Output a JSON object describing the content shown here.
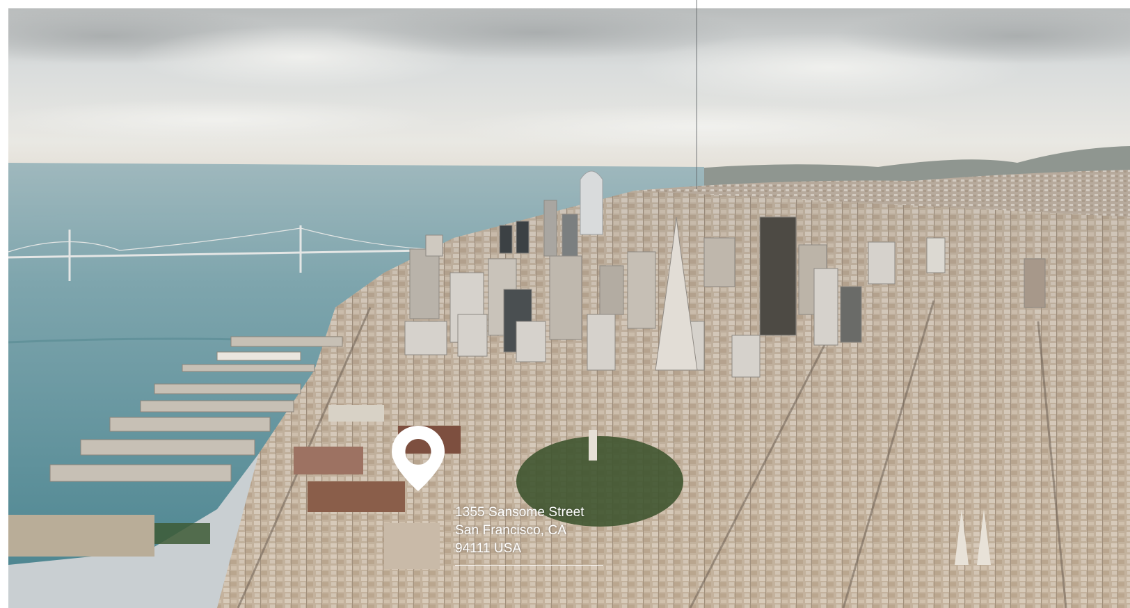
{
  "address": {
    "street": "1355 Sansome Street",
    "city": "San Francisco, CA",
    "postal": "94111 USA"
  },
  "colors": {
    "pin": "#ffffff",
    "text": "#ffffff",
    "water": "#6f9aa3",
    "sky": "#dfe3e4"
  },
  "icons": {
    "pin": "location-pin-icon"
  }
}
